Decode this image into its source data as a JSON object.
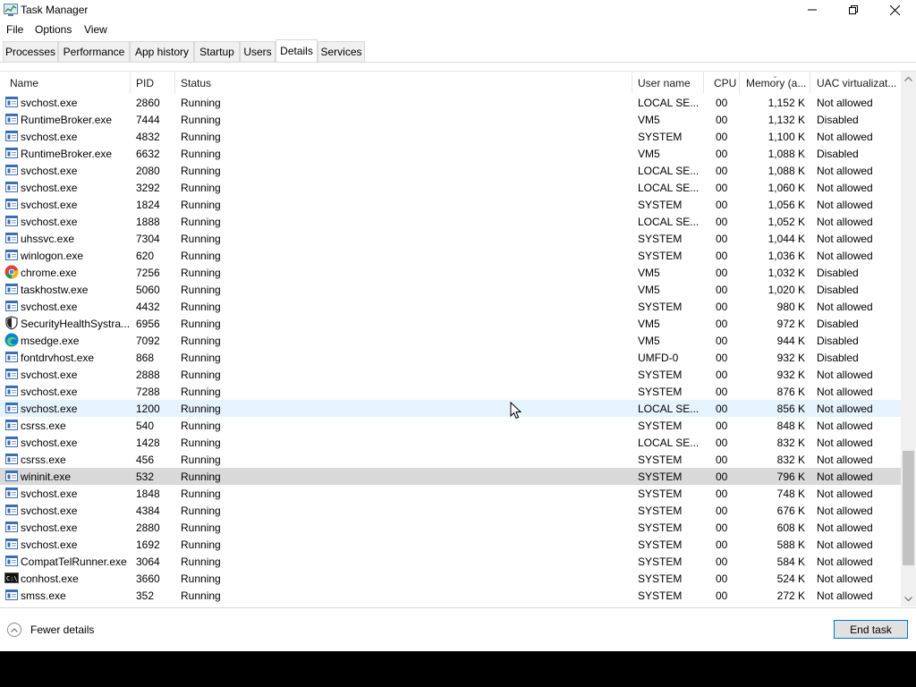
{
  "window": {
    "title": "Task Manager",
    "menu": [
      "File",
      "Options",
      "View"
    ],
    "tabs": [
      "Processes",
      "Performance",
      "App history",
      "Startup",
      "Users",
      "Details",
      "Services"
    ],
    "active_tab": "Details"
  },
  "table": {
    "columns": [
      "Name",
      "PID",
      "Status",
      "User name",
      "CPU",
      "Memory (a...",
      "UAC virtualizat..."
    ],
    "rows": [
      {
        "name": "svchost.exe",
        "pid": "2860",
        "status": "Running",
        "user": "LOCAL SE...",
        "cpu": "00",
        "mem": "1,152 K",
        "uac": "Not allowed",
        "icon": "service-icon"
      },
      {
        "name": "RuntimeBroker.exe",
        "pid": "7444",
        "status": "Running",
        "user": "VM5",
        "cpu": "00",
        "mem": "1,132 K",
        "uac": "Disabled",
        "icon": "service-icon"
      },
      {
        "name": "svchost.exe",
        "pid": "4832",
        "status": "Running",
        "user": "SYSTEM",
        "cpu": "00",
        "mem": "1,100 K",
        "uac": "Not allowed",
        "icon": "service-icon"
      },
      {
        "name": "RuntimeBroker.exe",
        "pid": "6632",
        "status": "Running",
        "user": "VM5",
        "cpu": "00",
        "mem": "1,088 K",
        "uac": "Disabled",
        "icon": "service-icon"
      },
      {
        "name": "svchost.exe",
        "pid": "2080",
        "status": "Running",
        "user": "LOCAL SE...",
        "cpu": "00",
        "mem": "1,088 K",
        "uac": "Not allowed",
        "icon": "service-icon"
      },
      {
        "name": "svchost.exe",
        "pid": "3292",
        "status": "Running",
        "user": "LOCAL SE...",
        "cpu": "00",
        "mem": "1,060 K",
        "uac": "Not allowed",
        "icon": "service-icon"
      },
      {
        "name": "svchost.exe",
        "pid": "1824",
        "status": "Running",
        "user": "SYSTEM",
        "cpu": "00",
        "mem": "1,056 K",
        "uac": "Not allowed",
        "icon": "service-icon"
      },
      {
        "name": "svchost.exe",
        "pid": "1888",
        "status": "Running",
        "user": "LOCAL SE...",
        "cpu": "00",
        "mem": "1,052 K",
        "uac": "Not allowed",
        "icon": "service-icon"
      },
      {
        "name": "uhssvc.exe",
        "pid": "7304",
        "status": "Running",
        "user": "SYSTEM",
        "cpu": "00",
        "mem": "1,044 K",
        "uac": "Not allowed",
        "icon": "service-icon"
      },
      {
        "name": "winlogon.exe",
        "pid": "620",
        "status": "Running",
        "user": "SYSTEM",
        "cpu": "00",
        "mem": "1,036 K",
        "uac": "Not allowed",
        "icon": "service-icon"
      },
      {
        "name": "chrome.exe",
        "pid": "7256",
        "status": "Running",
        "user": "VM5",
        "cpu": "00",
        "mem": "1,032 K",
        "uac": "Disabled",
        "icon": "chrome-icon"
      },
      {
        "name": "taskhostw.exe",
        "pid": "5060",
        "status": "Running",
        "user": "VM5",
        "cpu": "00",
        "mem": "1,020 K",
        "uac": "Disabled",
        "icon": "service-icon"
      },
      {
        "name": "svchost.exe",
        "pid": "4432",
        "status": "Running",
        "user": "SYSTEM",
        "cpu": "00",
        "mem": "980 K",
        "uac": "Not allowed",
        "icon": "service-icon"
      },
      {
        "name": "SecurityHealthSystra...",
        "pid": "6956",
        "status": "Running",
        "user": "VM5",
        "cpu": "00",
        "mem": "972 K",
        "uac": "Disabled",
        "icon": "shield-icon"
      },
      {
        "name": "msedge.exe",
        "pid": "7092",
        "status": "Running",
        "user": "VM5",
        "cpu": "00",
        "mem": "944 K",
        "uac": "Disabled",
        "icon": "edge-icon"
      },
      {
        "name": "fontdrvhost.exe",
        "pid": "868",
        "status": "Running",
        "user": "UMFD-0",
        "cpu": "00",
        "mem": "932 K",
        "uac": "Disabled",
        "icon": "service-icon"
      },
      {
        "name": "svchost.exe",
        "pid": "2888",
        "status": "Running",
        "user": "SYSTEM",
        "cpu": "00",
        "mem": "932 K",
        "uac": "Not allowed",
        "icon": "service-icon"
      },
      {
        "name": "svchost.exe",
        "pid": "7288",
        "status": "Running",
        "user": "SYSTEM",
        "cpu": "00",
        "mem": "876 K",
        "uac": "Not allowed",
        "icon": "service-icon"
      },
      {
        "name": "svchost.exe",
        "pid": "1200",
        "status": "Running",
        "user": "LOCAL SE...",
        "cpu": "00",
        "mem": "856 K",
        "uac": "Not allowed",
        "icon": "service-icon",
        "state": "hover"
      },
      {
        "name": "csrss.exe",
        "pid": "540",
        "status": "Running",
        "user": "SYSTEM",
        "cpu": "00",
        "mem": "848 K",
        "uac": "Not allowed",
        "icon": "service-icon"
      },
      {
        "name": "svchost.exe",
        "pid": "1428",
        "status": "Running",
        "user": "LOCAL SE...",
        "cpu": "00",
        "mem": "832 K",
        "uac": "Not allowed",
        "icon": "service-icon"
      },
      {
        "name": "csrss.exe",
        "pid": "456",
        "status": "Running",
        "user": "SYSTEM",
        "cpu": "00",
        "mem": "832 K",
        "uac": "Not allowed",
        "icon": "service-icon"
      },
      {
        "name": "wininit.exe",
        "pid": "532",
        "status": "Running",
        "user": "SYSTEM",
        "cpu": "00",
        "mem": "796 K",
        "uac": "Not allowed",
        "icon": "service-icon",
        "state": "selected"
      },
      {
        "name": "svchost.exe",
        "pid": "1848",
        "status": "Running",
        "user": "SYSTEM",
        "cpu": "00",
        "mem": "748 K",
        "uac": "Not allowed",
        "icon": "service-icon"
      },
      {
        "name": "svchost.exe",
        "pid": "4384",
        "status": "Running",
        "user": "SYSTEM",
        "cpu": "00",
        "mem": "676 K",
        "uac": "Not allowed",
        "icon": "service-icon"
      },
      {
        "name": "svchost.exe",
        "pid": "2880",
        "status": "Running",
        "user": "SYSTEM",
        "cpu": "00",
        "mem": "608 K",
        "uac": "Not allowed",
        "icon": "service-icon"
      },
      {
        "name": "svchost.exe",
        "pid": "1692",
        "status": "Running",
        "user": "SYSTEM",
        "cpu": "00",
        "mem": "588 K",
        "uac": "Not allowed",
        "icon": "service-icon"
      },
      {
        "name": "CompatTelRunner.exe",
        "pid": "3064",
        "status": "Running",
        "user": "SYSTEM",
        "cpu": "00",
        "mem": "584 K",
        "uac": "Not allowed",
        "icon": "service-icon"
      },
      {
        "name": "conhost.exe",
        "pid": "3660",
        "status": "Running",
        "user": "SYSTEM",
        "cpu": "00",
        "mem": "524 K",
        "uac": "Not allowed",
        "icon": "console-icon"
      },
      {
        "name": "smss.exe",
        "pid": "352",
        "status": "Running",
        "user": "SYSTEM",
        "cpu": "00",
        "mem": "272 K",
        "uac": "Not allowed",
        "icon": "service-icon"
      }
    ]
  },
  "footer": {
    "fewer_details": "Fewer details",
    "end_task": "End task"
  },
  "colors": {
    "hover_row": "#e5f3ff",
    "selected_row": "#d9d9d9",
    "accent_border": "#0078d7"
  }
}
